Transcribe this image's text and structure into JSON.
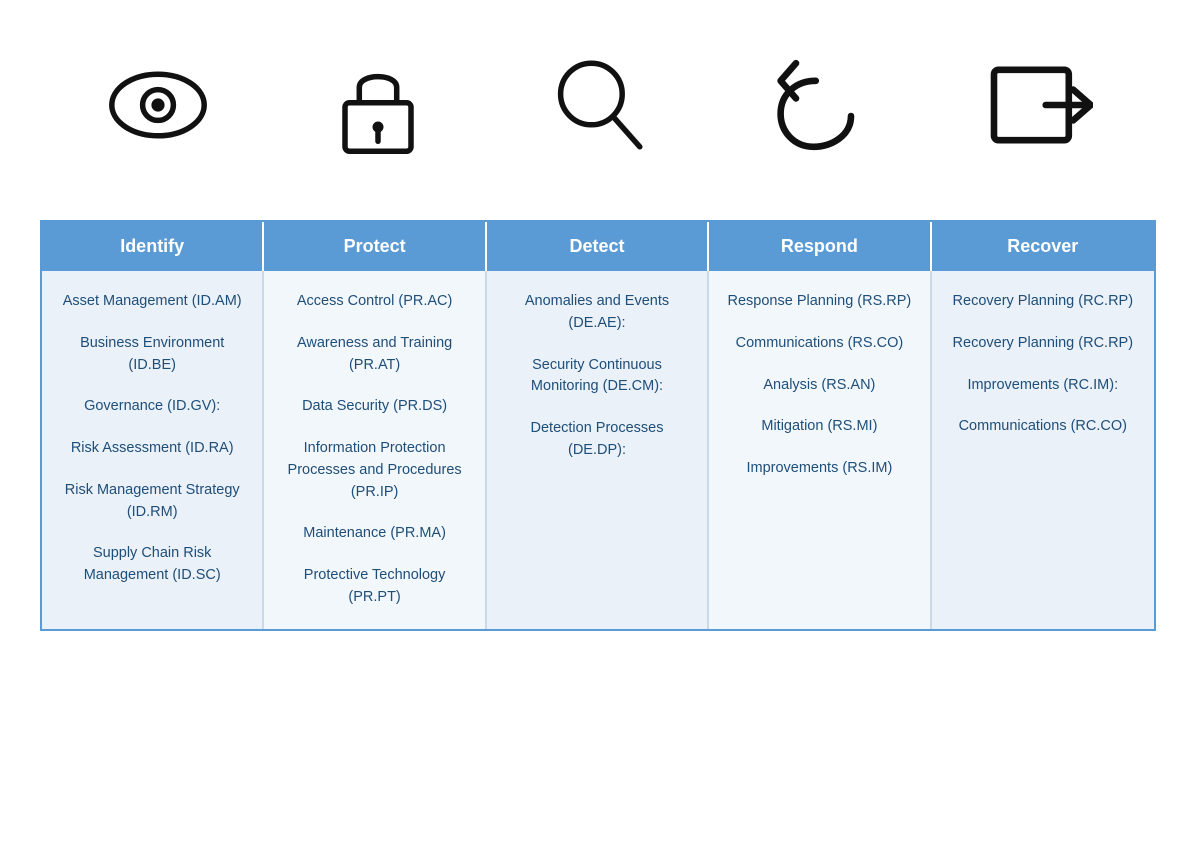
{
  "icons": [
    {
      "name": "eye-icon",
      "label": "Identify"
    },
    {
      "name": "lock-icon",
      "label": "Protect"
    },
    {
      "name": "search-icon",
      "label": "Detect"
    },
    {
      "name": "respond-icon",
      "label": "Respond"
    },
    {
      "name": "recover-icon",
      "label": "Recover"
    }
  ],
  "columns": [
    {
      "header": "Identify",
      "items": [
        "Asset Management (ID.AM)",
        "Business Environment (ID.BE)",
        "Governance (ID.GV):",
        "Risk Assessment (ID.RA)",
        "Risk Management Strategy (ID.RM)",
        "Supply Chain Risk Management (ID.SC)"
      ]
    },
    {
      "header": "Protect",
      "items": [
        "Access Control (PR.AC)",
        "Awareness and Training (PR.AT)",
        "Data Security (PR.DS)",
        "Information Protection Processes and Procedures (PR.IP)",
        "Maintenance (PR.MA)",
        "Protective Technology (PR.PT)"
      ]
    },
    {
      "header": "Detect",
      "items": [
        "Anomalies and Events (DE.AE):",
        "Security Continuous Monitoring (DE.CM):",
        "Detection Processes (DE.DP):"
      ]
    },
    {
      "header": "Respond",
      "items": [
        "Response Planning (RS.RP)",
        "Communications (RS.CO)",
        "Analysis (RS.AN)",
        "Mitigation (RS.MI)",
        "Improvements (RS.IM)"
      ]
    },
    {
      "header": "Recover",
      "items": [
        "Recovery Planning (RC.RP)",
        "Recovery Planning (RC.RP)",
        "Improvements (RC.IM):",
        "Communications (RC.CO)"
      ]
    }
  ]
}
